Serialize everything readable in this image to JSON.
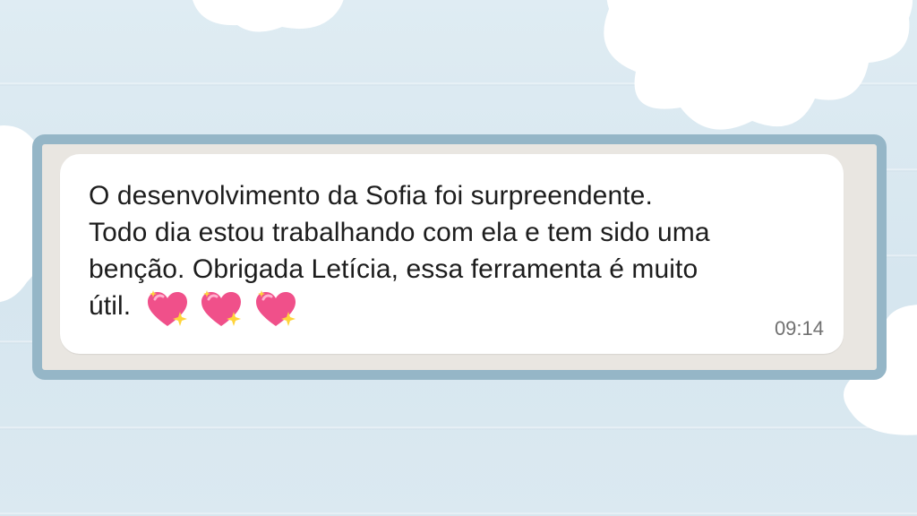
{
  "message": {
    "lines": [
      "O desenvolvimento da Sofia foi surpreendente.",
      "Todo dia estou trabalhando com ela e tem sido uma",
      "benção. Obrigada Letícia, essa ferramenta é muito",
      "útil."
    ],
    "emoji": [
      "sparkling-heart",
      "sparkling-heart",
      "sparkling-heart"
    ],
    "time": "09:14"
  },
  "colors": {
    "frame_border": "#95b6c7",
    "bubble_bg": "#ffffff",
    "chat_bg": "#e9e6e1",
    "page_bg": "#dbe9f1",
    "heart": "#f0508a"
  }
}
